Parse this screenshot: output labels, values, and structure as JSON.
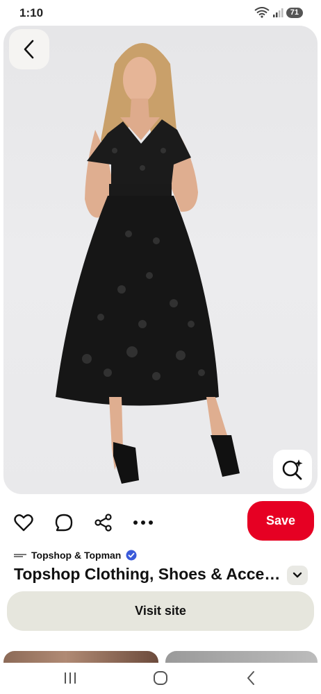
{
  "status_bar": {
    "time": "1:10",
    "battery": "71"
  },
  "pin": {
    "source_name": "Topshop & Topman",
    "title": "Topshop Clothing, Shoes & Accessories",
    "save_label": "Save",
    "visit_label": "Visit site"
  },
  "icons": {
    "back": "chevron-left-icon",
    "lens": "visual-search-icon",
    "like": "heart-icon",
    "comment": "comment-icon",
    "share": "share-icon",
    "more": "more-icon",
    "expand": "chevron-down-icon"
  },
  "colors": {
    "save": "#e60023",
    "visit": "#e6e6dd",
    "verified": "#3a5ad9"
  }
}
